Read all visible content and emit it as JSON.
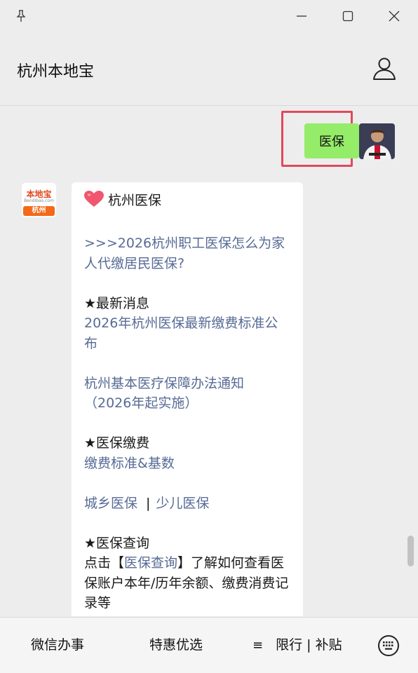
{
  "window": {
    "pin_icon": "pin-icon",
    "minimize_icon": "minimize-icon",
    "maximize_icon": "maximize-icon",
    "close_icon": "close-icon"
  },
  "header": {
    "title": "杭州本地宝",
    "profile_icon": "person-icon"
  },
  "messages": {
    "outgoing": {
      "text": "医保",
      "highlight_color": "#e0495b",
      "bubble_color": "#95ec69"
    },
    "bot_avatar": {
      "logo": "本地宝",
      "site": "Bendibao.com",
      "city": "杭州"
    },
    "incoming": {
      "title": "杭州医保",
      "link1": ">>>2026杭州职工医保怎么为家人代缴居民医保?",
      "section1": "★最新消息",
      "link2": "2026年杭州医保最新缴费标准公布",
      "link3": "杭州基本医疗保障办法通知（2026年起实施）",
      "section2": "★医保缴费",
      "link4": "缴费标准&基数",
      "link5a": "城乡医保",
      "link5sep": "|",
      "link5b": "少儿医保",
      "section3": "★医保查询",
      "query_prefix": "点击【",
      "query_link": "医保查询",
      "query_suffix": "】了解如何查看医保账户本年/历年余额、缴费消费记录等"
    }
  },
  "bottom_menu": {
    "item1": "微信办事",
    "item2": "特惠优选",
    "item3_icon": "≡",
    "item3": "限行 | 补贴",
    "keyboard_icon": "keyboard-icon"
  },
  "colors": {
    "link": "#576b95",
    "background": "#ededed"
  }
}
